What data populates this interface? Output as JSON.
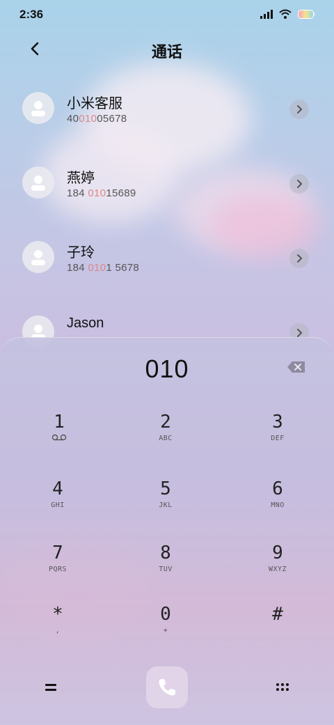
{
  "status_bar": {
    "time": "2:36",
    "icons": [
      "signal-icon",
      "wifi-icon",
      "battery-icon"
    ]
  },
  "header": {
    "title": "通话",
    "back_icon": "chevron-left-icon"
  },
  "contacts": [
    {
      "name": "小米客服",
      "number_parts": [
        "40",
        "010",
        "05678"
      ]
    },
    {
      "name": "燕婷",
      "number_parts": [
        "184 ",
        "010",
        "15689"
      ]
    },
    {
      "name": "子玲",
      "number_parts": [
        "184 ",
        "010",
        "1 5678"
      ]
    },
    {
      "name": "Jason",
      "number_parts": [
        "",
        "",
        ""
      ]
    }
  ],
  "dialer": {
    "entered": "010",
    "backspace_icon": "backspace-icon",
    "keys": [
      {
        "num": "1",
        "letters": ""
      },
      {
        "num": "2",
        "letters": "ABC"
      },
      {
        "num": "3",
        "letters": "DEF"
      },
      {
        "num": "4",
        "letters": "GHI"
      },
      {
        "num": "5",
        "letters": "JKL"
      },
      {
        "num": "6",
        "letters": "MNO"
      },
      {
        "num": "7",
        "letters": "PQRS"
      },
      {
        "num": "8",
        "letters": "TUV"
      },
      {
        "num": "9",
        "letters": "WXYZ"
      },
      {
        "num": "*",
        "letters": ","
      },
      {
        "num": "0",
        "letters": "+"
      },
      {
        "num": "#",
        "letters": ""
      }
    ]
  },
  "bottom_bar": {
    "left_icon": "menu-icon",
    "center_icon": "phone-icon",
    "right_icon": "dialpad-grid-icon"
  },
  "colors": {
    "highlight": "#d98a8a",
    "text": "#111111",
    "chevron_bg": "#b4b4c3"
  }
}
